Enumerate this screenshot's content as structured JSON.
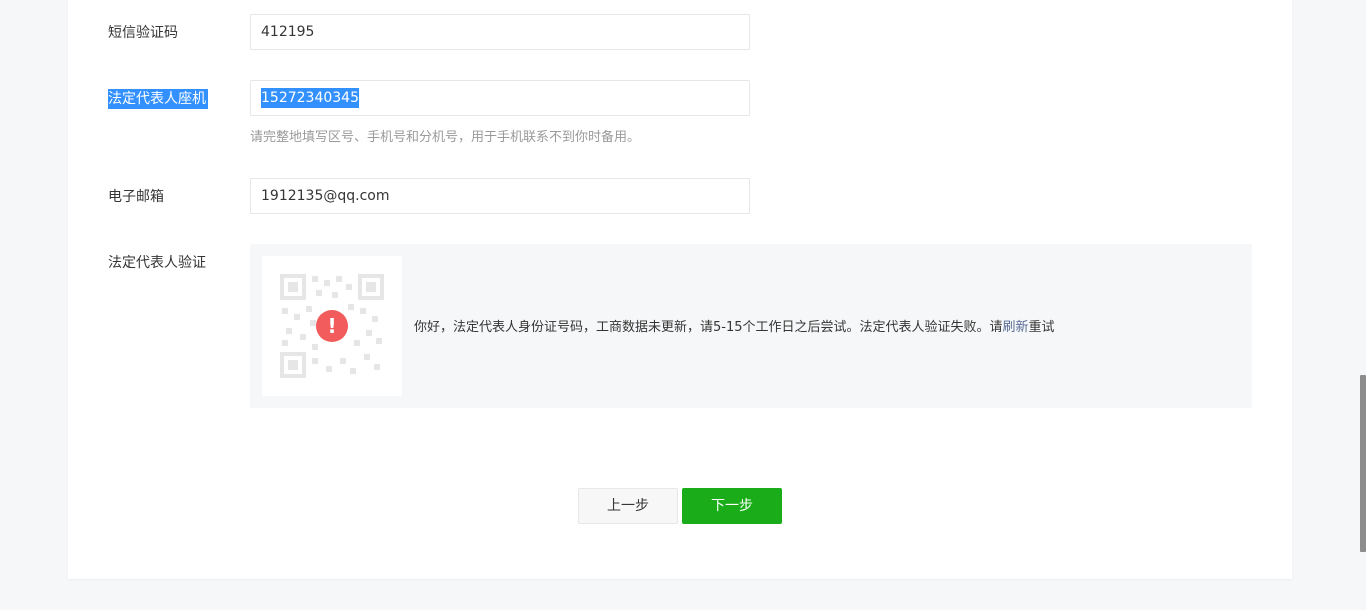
{
  "form": {
    "sms_code": {
      "label": "短信验证码",
      "value": "412195"
    },
    "phone": {
      "label": "法定代表人座机",
      "value": "15272340345",
      "hint": "请完整地填写区号、手机号和分机号，用于手机联系不到你时备用。"
    },
    "email": {
      "label": "电子邮箱",
      "value": "1912135@qq.com"
    },
    "verify": {
      "label": "法定代表人验证",
      "message_pre": "你好，法定代表人身份证号码，工商数据未更新，请5-15个工作日之后尝试。法定代表人验证失败。请",
      "refresh_link": "刷新",
      "message_post": "重试",
      "warn_glyph": "!",
      "icon": "warning-icon"
    }
  },
  "buttons": {
    "prev": "上一步",
    "next": "下一步"
  },
  "colors": {
    "primary": "#1aad19",
    "link": "#576b95",
    "warning": "#f25c5c",
    "selection": "#3390ff"
  }
}
